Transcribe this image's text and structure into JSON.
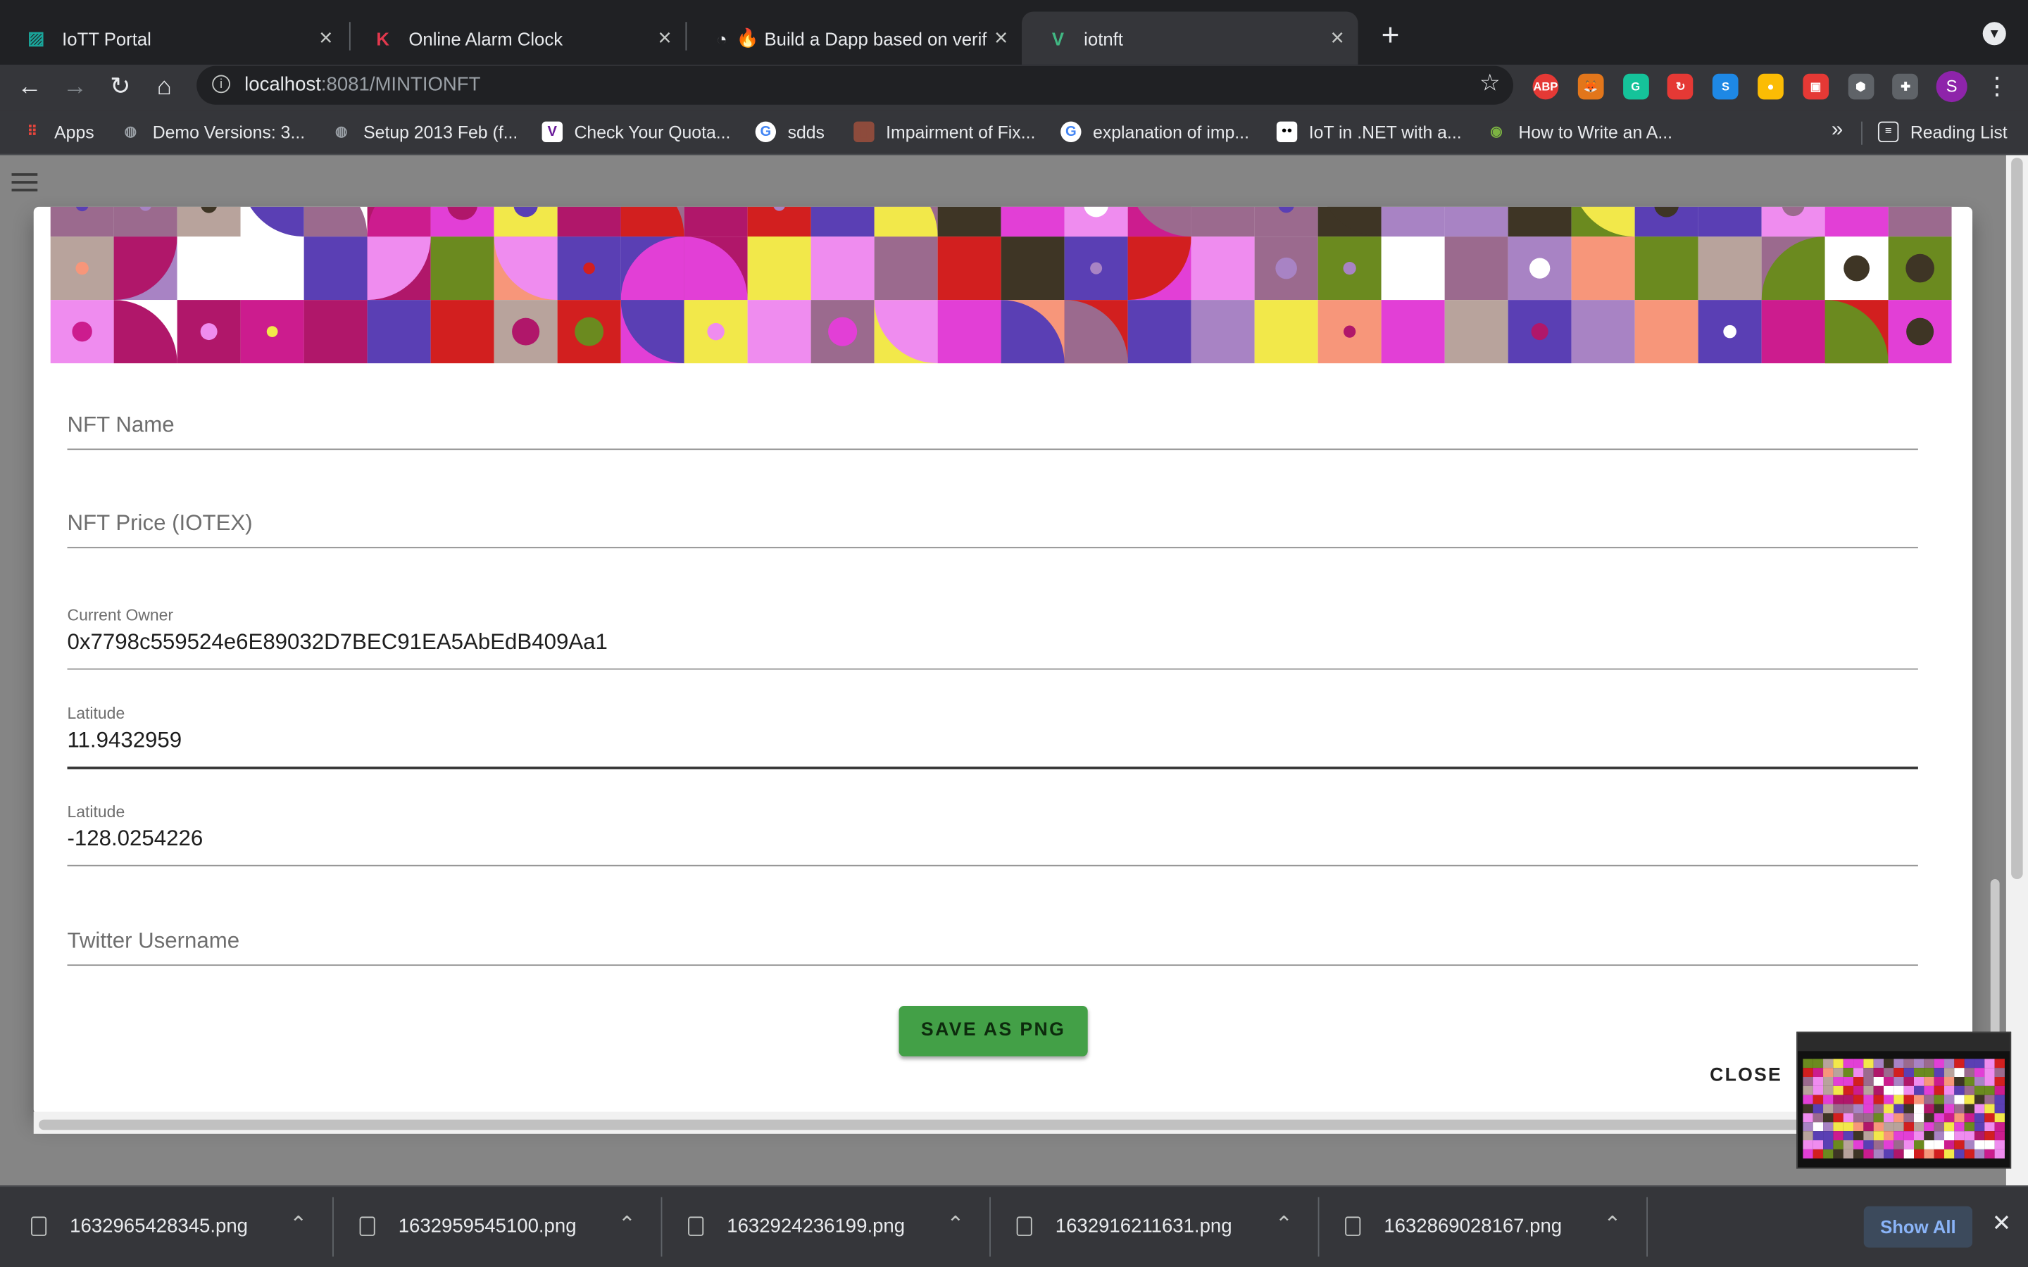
{
  "browser": {
    "tabs": [
      {
        "title": "IoTT Portal",
        "icon": "iott-portal-icon",
        "icon_color": "#1aa59a",
        "active": false
      },
      {
        "title": "Online Alarm Clock",
        "icon": "kuku-k-icon",
        "icon_color": "#e2384d",
        "active": false
      },
      {
        "title": "Build a Dapp based on verif",
        "icon": "fire-icon",
        "icon_color": "#f4a623",
        "active": false
      },
      {
        "title": "iotnft",
        "icon": "vue-icon",
        "icon_color": "#41b883",
        "active": true
      }
    ],
    "url_host": "localhost",
    "url_path": ":8081/MINTIONFT",
    "extensions": [
      {
        "name": "adblock-plus-icon",
        "label": "ABP",
        "color": "#e53935"
      },
      {
        "name": "metamask-icon",
        "label": "🦊",
        "color": "#e2761b"
      },
      {
        "name": "grammarly-icon",
        "label": "G",
        "color": "#15c39a"
      },
      {
        "name": "refresh-ext-icon",
        "label": "↻",
        "color": "#e53935"
      },
      {
        "name": "s-ext-icon",
        "label": "S",
        "color": "#1e88e5"
      },
      {
        "name": "chrome-ext-icon",
        "label": "●",
        "color": "#fbbc04"
      },
      {
        "name": "dice-ext-icon",
        "label": "▣",
        "color": "#e53935"
      },
      {
        "name": "github-icon",
        "label": "⬢",
        "color": "#5f6368"
      },
      {
        "name": "puzzle-icon",
        "label": "✚",
        "color": "#5f6368"
      }
    ],
    "avatar_letter": "S",
    "bookmarks": [
      {
        "label": "Apps",
        "icon": "apps-grid-icon",
        "icon_color": "#e8453c"
      },
      {
        "label": "Demo Versions: 3...",
        "icon": "globe-icon",
        "icon_color": "#9aa0a6"
      },
      {
        "label": "Setup 2013 Feb (f...",
        "icon": "globe-icon",
        "icon_color": "#9aa0a6"
      },
      {
        "label": "Check Your Quota...",
        "icon": "shield-v-icon",
        "icon_color": "#6a1b9a"
      },
      {
        "label": "sdds",
        "icon": "google-icon",
        "icon_color": "#4285f4"
      },
      {
        "label": "Impairment of Fix...",
        "icon": "book-icon",
        "icon_color": "#8d4b3c"
      },
      {
        "label": "explanation of imp...",
        "icon": "google-icon",
        "icon_color": "#4285f4"
      },
      {
        "label": "IoT in .NET with a...",
        "icon": "medium-icon",
        "icon_color": "#000000"
      },
      {
        "label": "How to Write an A...",
        "icon": "bookmark-green-icon",
        "icon_color": "#7cb342"
      }
    ],
    "bookmarks_overflow": "»",
    "reading_list": "Reading List"
  },
  "dialog": {
    "fields": [
      {
        "label": "NFT Name",
        "value": ""
      },
      {
        "label": "NFT Price (IOTEX)",
        "value": ""
      },
      {
        "label": "Current Owner",
        "value": "0x7798c559524e6E89032D7BEC91EA5AbEdB409Aa1"
      },
      {
        "label": "Latitude",
        "value": "11.9432959"
      },
      {
        "label": "Latitude",
        "value": "-128.0254226"
      },
      {
        "label": "Twitter Username",
        "value": ""
      }
    ],
    "save_label": "SAVE AS PNG",
    "close_label": "CLOSE",
    "accent_green": "#43a047"
  },
  "downloads": {
    "files": [
      "1632965428345.png",
      "1632959545100.png",
      "1632924236199.png",
      "1632916211631.png",
      "1632869028167.png"
    ],
    "show_all": "Show All"
  }
}
